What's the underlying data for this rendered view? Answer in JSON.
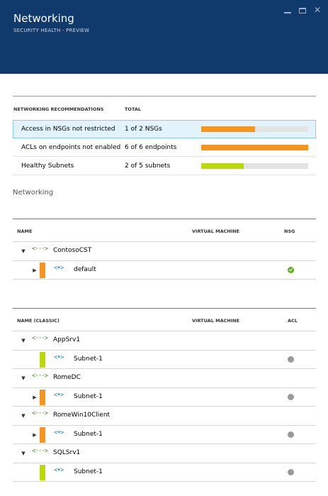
{
  "window": {
    "title": "Networking",
    "subtitle": "SECURITY HEALTH - PREVIEW",
    "controls": [
      "minimize-icon",
      "maximize-icon",
      "close-icon"
    ]
  },
  "recommendations": {
    "headers": {
      "name": "NETWORKING RECOMMENDATIONS",
      "total": "TOTAL"
    },
    "rows": [
      {
        "label": "Access in NSGs not restricted",
        "total": "1 of 2 NSGs",
        "progress": 0.5,
        "color": "#f7941d",
        "selected": true
      },
      {
        "label": "ACLs on endpoints not enabled",
        "total": "6 of 6 endpoints",
        "progress": 1.0,
        "color": "#f7941d",
        "selected": false
      },
      {
        "label": "Healthy Subnets",
        "total": "2 of 5 subnets",
        "progress": 0.4,
        "color": "#bad80a",
        "selected": false
      }
    ]
  },
  "section_label": "Networking",
  "arm_table": {
    "headers": {
      "name": "NAME",
      "vm": "VIRTUAL MACHINE",
      "status": "NSG"
    },
    "vnet_icon": "<···>",
    "subnet_icon": "<•>",
    "rows": [
      {
        "type": "vnet",
        "name": "ContosoCST",
        "expanded": true
      },
      {
        "type": "subnet",
        "name": "default",
        "has_caret": true,
        "stripe": "#f7941d",
        "status": "ok"
      }
    ]
  },
  "classic_table": {
    "headers": {
      "name": "NAME (CLASSIC)",
      "vm": "VIRTUAL MACHINE",
      "status": "ACL"
    },
    "vnet_icon": "<···>",
    "subnet_icon": "<•>",
    "rows": [
      {
        "type": "vnet",
        "name": "AppSrv1",
        "expanded": true
      },
      {
        "type": "subnet",
        "name": "Subnet-1",
        "has_caret": false,
        "stripe": "#bad80a",
        "status": "none"
      },
      {
        "type": "vnet",
        "name": "RomeDC",
        "expanded": true
      },
      {
        "type": "subnet",
        "name": "Subnet-1",
        "has_caret": true,
        "stripe": "#f7941d",
        "status": "none"
      },
      {
        "type": "vnet",
        "name": "RomeWin10Client",
        "expanded": true
      },
      {
        "type": "subnet",
        "name": "Subnet-1",
        "has_caret": true,
        "stripe": "#f7941d",
        "status": "none"
      },
      {
        "type": "vnet",
        "name": "SQLSrv1",
        "expanded": true
      },
      {
        "type": "subnet",
        "name": "Subnet-1",
        "has_caret": false,
        "stripe": "#bad80a",
        "status": "none"
      }
    ]
  }
}
